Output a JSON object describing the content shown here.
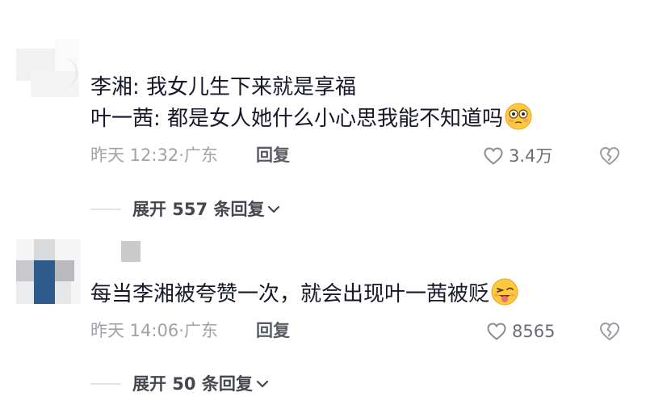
{
  "comments": [
    {
      "lines": [
        "李湘: 我女儿生下来就是享福",
        "叶一茜: 都是女人她什么小心思我能不知道吗"
      ],
      "emoji": "flushed-face-emoji",
      "time_location": "昨天 12:32·广东",
      "reply_label": "回复",
      "likes": "3.4万",
      "expand_label": "展开 557 条回复"
    },
    {
      "lines": [
        "每当李湘被夸赞一次，就会出现叶一茜被贬"
      ],
      "emoji": "winking-tongue-face-emoji",
      "time_location": "昨天 14:06·广东",
      "reply_label": "回复",
      "likes": "8565",
      "expand_label": "展开 50 条回复"
    }
  ],
  "icons": {
    "like": "heart-outline-icon",
    "dislike": "broken-heart-icon",
    "expand": "chevron-down-icon"
  },
  "colors": {
    "text": "#16182a",
    "meta": "#a0a2a8",
    "emoji_face": "#ffc83d",
    "avatar_blue": "#2e5a8c"
  }
}
